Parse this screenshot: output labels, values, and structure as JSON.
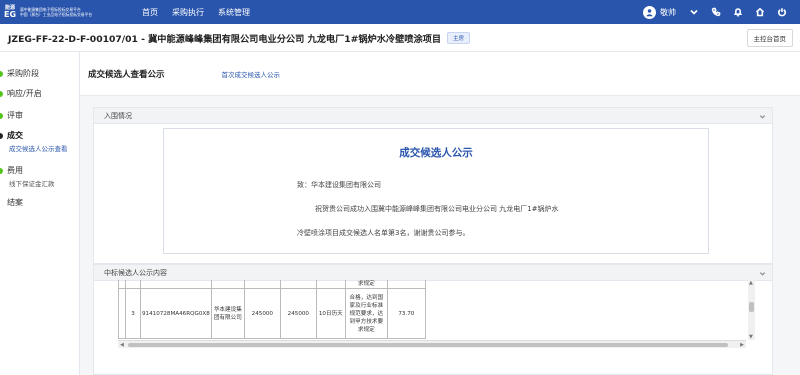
{
  "header": {
    "logo_mark_top": "能源",
    "logo_mark_bottom": "EG",
    "logo_line1": "冀中能源集团电子招标投标交易平台",
    "logo_line2": "中国（邢台）工业品电子招标投标交易平台",
    "nav": [
      "首页",
      "采购执行",
      "系统管理"
    ],
    "avatar_initial": "👤",
    "username": "敬帅",
    "icons": [
      "chevron-down-icon",
      "phone-icon",
      "bell-icon",
      "home-icon",
      "power-icon"
    ]
  },
  "project": {
    "title": "JZEG-FF-22-D-F-00107/01 - 冀中能源峰峰集团有限公司电业分公司 九龙电厂1#锅炉水冷壁喷涂项目",
    "tag": "主房",
    "home_button": "主控台首页"
  },
  "sidebar": {
    "steps": [
      {
        "label": "采购阶段",
        "status": "done"
      },
      {
        "label": "响应/开启",
        "status": "done"
      },
      {
        "label": "评审",
        "status": "done"
      },
      {
        "label": "成交",
        "status": "active",
        "subs": [
          {
            "label": "成交候选人公示查看",
            "current": true
          }
        ]
      },
      {
        "label": "费用",
        "status": "done",
        "subs": [
          {
            "label": "线下保证金汇款",
            "current": false
          }
        ]
      },
      {
        "label": "结案",
        "status": "none"
      }
    ]
  },
  "main": {
    "tab_title": "成交候选人查看公示",
    "tab_link": "首次成交候选人公示",
    "section1": {
      "header": "入围情况",
      "notice_title": "成交候选人公示",
      "to_line": "致：华本建设集团有限公司",
      "body_line1": "祝贺贵公司成功入围冀中能源峰峰集团有限公司电业分公司 九龙电厂1#锅炉水",
      "body_line2": "冷壁喷涂项目成交候选人名单第3名，谢谢贵公司参与。"
    },
    "section2": {
      "header": "中标候选人公示内容",
      "table": {
        "top_fragment": "求规定",
        "row": {
          "index": "3",
          "credit_code": "91410728MA46RQG0X8",
          "company": "华本建设集团有限公司",
          "price1": "245000",
          "price2": "245000",
          "period": "10日历天",
          "requirement": "合格，达到国家及行业标准规范要求，达到甲方技术要求规定",
          "score": "73.70"
        }
      }
    }
  },
  "colors": {
    "brand": "#2a55ad",
    "done_dot": "#52c41a"
  }
}
